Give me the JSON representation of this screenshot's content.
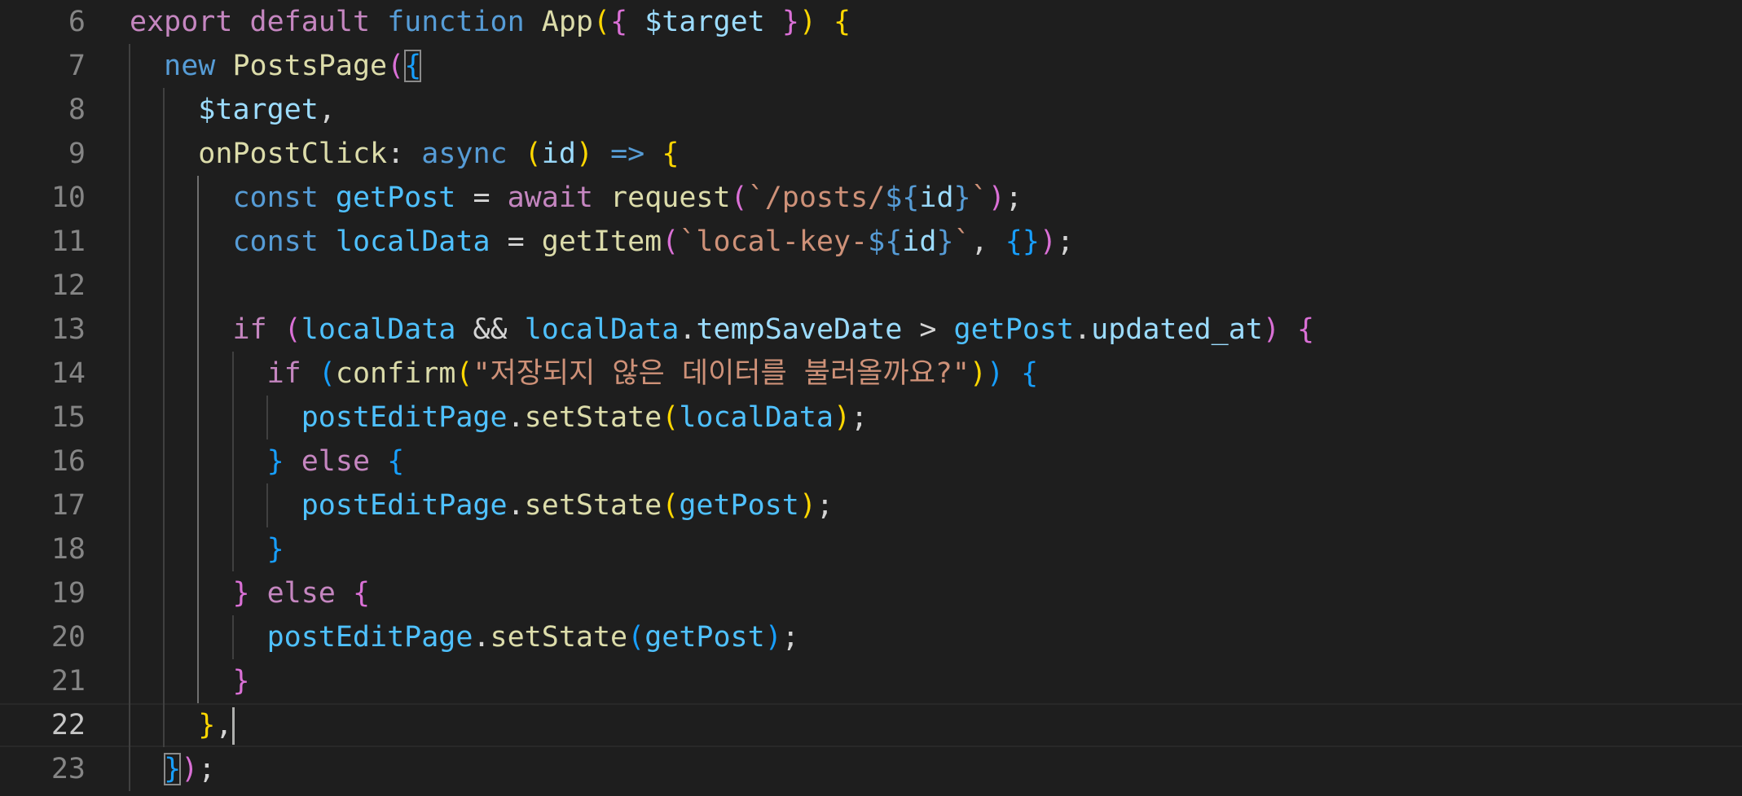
{
  "editor": {
    "language": "javascript",
    "cursor_line": 22,
    "colors": {
      "background": "#1e1e1e",
      "line_number": "#858585",
      "line_number_active": "#c6c6c6",
      "keyword_control": "#c586c0",
      "keyword_storage": "#569cd6",
      "function": "#dcdcaa",
      "variable": "#9cdcfe",
      "constant": "#4fc1ff",
      "string": "#ce9178",
      "bracket_1": "#ffd700",
      "bracket_2": "#da70d6",
      "bracket_3": "#179fff"
    },
    "lines": [
      {
        "num": "6",
        "tokens": [
          [
            "kw-p",
            "export"
          ],
          [
            "pn",
            " "
          ],
          [
            "kw-p",
            "default"
          ],
          [
            "pn",
            " "
          ],
          [
            "kw-b",
            "function"
          ],
          [
            "pn",
            " "
          ],
          [
            "fn",
            "App"
          ],
          [
            "b1",
            "("
          ],
          [
            "b2",
            "{"
          ],
          [
            "pn",
            " "
          ],
          [
            "var",
            "$target"
          ],
          [
            "pn",
            " "
          ],
          [
            "b2",
            "}"
          ],
          [
            "b1",
            ")"
          ],
          [
            "pn",
            " "
          ],
          [
            "b1",
            "{"
          ]
        ]
      },
      {
        "num": "7",
        "tokens": [
          [
            "pn",
            "  "
          ],
          [
            "kw-b",
            "new"
          ],
          [
            "pn",
            " "
          ],
          [
            "fn",
            "PostsPage"
          ],
          [
            "b2",
            "("
          ],
          [
            "b3 bm",
            "{"
          ]
        ]
      },
      {
        "num": "8",
        "tokens": [
          [
            "pn",
            "    "
          ],
          [
            "var",
            "$target"
          ],
          [
            "pn",
            ","
          ]
        ]
      },
      {
        "num": "9",
        "tokens": [
          [
            "pn",
            "    "
          ],
          [
            "fn",
            "onPostClick"
          ],
          [
            "pn",
            ": "
          ],
          [
            "kw-b",
            "async"
          ],
          [
            "pn",
            " "
          ],
          [
            "b1",
            "("
          ],
          [
            "var",
            "id"
          ],
          [
            "b1",
            ")"
          ],
          [
            "pn",
            " "
          ],
          [
            "kw-b",
            "=>"
          ],
          [
            "pn",
            " "
          ],
          [
            "b1",
            "{"
          ]
        ]
      },
      {
        "num": "10",
        "tokens": [
          [
            "pn",
            "      "
          ],
          [
            "kw-b",
            "const"
          ],
          [
            "pn",
            " "
          ],
          [
            "cvar",
            "getPost"
          ],
          [
            "pn",
            " = "
          ],
          [
            "kw-p",
            "await"
          ],
          [
            "pn",
            " "
          ],
          [
            "fn",
            "request"
          ],
          [
            "b2",
            "("
          ],
          [
            "str",
            "`/posts/"
          ],
          [
            "kw-b",
            "${"
          ],
          [
            "var",
            "id"
          ],
          [
            "kw-b",
            "}"
          ],
          [
            "str",
            "`"
          ],
          [
            "b2",
            ")"
          ],
          [
            "pn",
            ";"
          ]
        ]
      },
      {
        "num": "11",
        "tokens": [
          [
            "pn",
            "      "
          ],
          [
            "kw-b",
            "const"
          ],
          [
            "pn",
            " "
          ],
          [
            "cvar",
            "localData"
          ],
          [
            "pn",
            " = "
          ],
          [
            "fn",
            "getItem"
          ],
          [
            "b2",
            "("
          ],
          [
            "str",
            "`local-key-"
          ],
          [
            "kw-b",
            "${"
          ],
          [
            "var",
            "id"
          ],
          [
            "kw-b",
            "}"
          ],
          [
            "str",
            "`"
          ],
          [
            "pn",
            ", "
          ],
          [
            "b3",
            "{}"
          ],
          [
            "b2",
            ")"
          ],
          [
            "pn",
            ";"
          ]
        ]
      },
      {
        "num": "12",
        "tokens": []
      },
      {
        "num": "13",
        "tokens": [
          [
            "pn",
            "      "
          ],
          [
            "kw-p",
            "if"
          ],
          [
            "pn",
            " "
          ],
          [
            "b2",
            "("
          ],
          [
            "cvar",
            "localData"
          ],
          [
            "pn",
            " && "
          ],
          [
            "cvar",
            "localData"
          ],
          [
            "pn",
            "."
          ],
          [
            "var",
            "tempSaveDate"
          ],
          [
            "pn",
            " > "
          ],
          [
            "cvar",
            "getPost"
          ],
          [
            "pn",
            "."
          ],
          [
            "var",
            "updated_at"
          ],
          [
            "b2",
            ")"
          ],
          [
            "pn",
            " "
          ],
          [
            "b2",
            "{"
          ]
        ]
      },
      {
        "num": "14",
        "tokens": [
          [
            "pn",
            "        "
          ],
          [
            "kw-p",
            "if"
          ],
          [
            "pn",
            " "
          ],
          [
            "b3",
            "("
          ],
          [
            "fn",
            "confirm"
          ],
          [
            "b1",
            "("
          ],
          [
            "str",
            "\"저장되지 않은 데이터를 불러올까요?\""
          ],
          [
            "b1",
            ")"
          ],
          [
            "b3",
            ")"
          ],
          [
            "pn",
            " "
          ],
          [
            "b3",
            "{"
          ]
        ]
      },
      {
        "num": "15",
        "tokens": [
          [
            "pn",
            "          "
          ],
          [
            "cvar",
            "postEditPage"
          ],
          [
            "pn",
            "."
          ],
          [
            "fn",
            "setState"
          ],
          [
            "b1",
            "("
          ],
          [
            "cvar",
            "localData"
          ],
          [
            "b1",
            ")"
          ],
          [
            "pn",
            ";"
          ]
        ]
      },
      {
        "num": "16",
        "tokens": [
          [
            "pn",
            "        "
          ],
          [
            "b3",
            "}"
          ],
          [
            "pn",
            " "
          ],
          [
            "kw-p",
            "else"
          ],
          [
            "pn",
            " "
          ],
          [
            "b3",
            "{"
          ]
        ]
      },
      {
        "num": "17",
        "tokens": [
          [
            "pn",
            "          "
          ],
          [
            "cvar",
            "postEditPage"
          ],
          [
            "pn",
            "."
          ],
          [
            "fn",
            "setState"
          ],
          [
            "b1",
            "("
          ],
          [
            "cvar",
            "getPost"
          ],
          [
            "b1",
            ")"
          ],
          [
            "pn",
            ";"
          ]
        ]
      },
      {
        "num": "18",
        "tokens": [
          [
            "pn",
            "        "
          ],
          [
            "b3",
            "}"
          ]
        ]
      },
      {
        "num": "19",
        "tokens": [
          [
            "pn",
            "      "
          ],
          [
            "b2",
            "}"
          ],
          [
            "pn",
            " "
          ],
          [
            "kw-p",
            "else"
          ],
          [
            "pn",
            " "
          ],
          [
            "b2",
            "{"
          ]
        ]
      },
      {
        "num": "20",
        "tokens": [
          [
            "pn",
            "        "
          ],
          [
            "cvar",
            "postEditPage"
          ],
          [
            "pn",
            "."
          ],
          [
            "fn",
            "setState"
          ],
          [
            "b3",
            "("
          ],
          [
            "cvar",
            "getPost"
          ],
          [
            "b3",
            ")"
          ],
          [
            "pn",
            ";"
          ]
        ]
      },
      {
        "num": "21",
        "tokens": [
          [
            "pn",
            "      "
          ],
          [
            "b2",
            "}"
          ]
        ]
      },
      {
        "num": "22",
        "tokens": [
          [
            "pn",
            "    "
          ],
          [
            "b1",
            "}"
          ],
          [
            "pn",
            ","
          ]
        ]
      },
      {
        "num": "23",
        "tokens": [
          [
            "pn",
            "  "
          ],
          [
            "b3 bm",
            "}"
          ],
          [
            "b2",
            ")"
          ],
          [
            "pn",
            ";"
          ]
        ]
      }
    ]
  }
}
